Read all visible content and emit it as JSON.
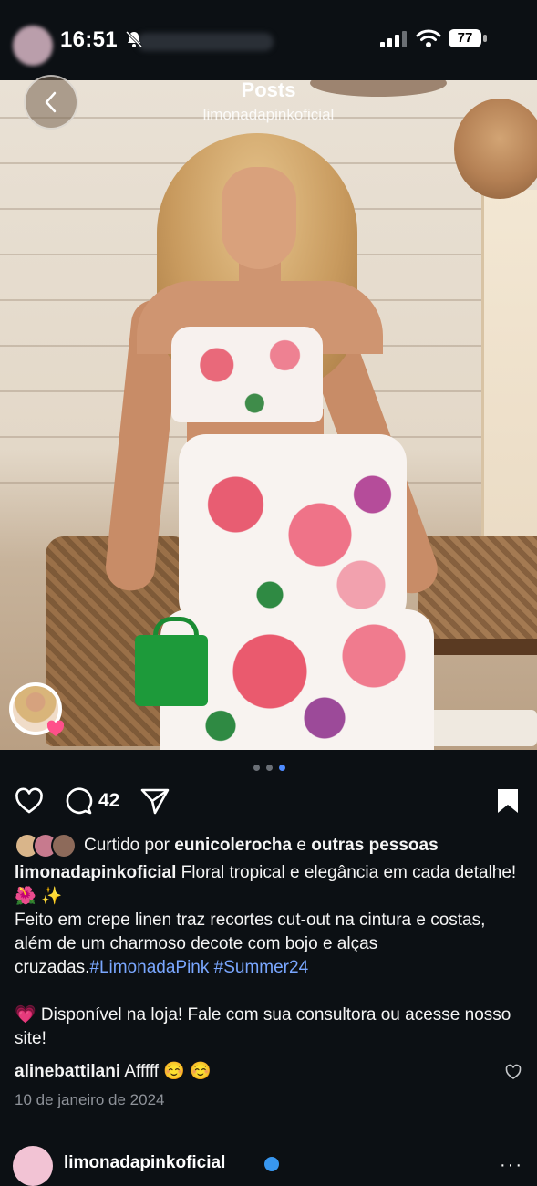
{
  "status": {
    "time": "16:51",
    "battery": "77"
  },
  "header": {
    "title": "Posts",
    "subtitle": "limonadapinkoficial"
  },
  "post": {
    "carousel": {
      "count": 3,
      "active_index": 2
    },
    "comment_count": "42",
    "liked_prefix": "Curtido por",
    "liked_user": "eunicolerocha",
    "liked_joiner": "e",
    "liked_others": "outras pessoas",
    "caption_user": "limonadapinkoficial",
    "caption_line1": "Floral tropical e elegância em cada detalhe! 🌺 ✨",
    "caption_line2": "Feito em crepe linen traz recortes cut-out na cintura e costas, além de um charmoso decote com bojo e alças cruzadas.",
    "hashtag1": "#LimonadaPink",
    "hashtag2": "#Summer24",
    "caption_line3": "💗 Disponível na loja! Fale com sua consultora ou acesse nosso site!",
    "comment_user": "alinebattilani",
    "comment_text": "Afffff ☺️ ☺️",
    "date": "10 de janeiro de 2024"
  },
  "next_post": {
    "username": "limonadapinkoficial"
  },
  "colors": {
    "background": "#0c1014",
    "hashtag": "#7aa7ff",
    "active_dot": "#4f8cff"
  }
}
